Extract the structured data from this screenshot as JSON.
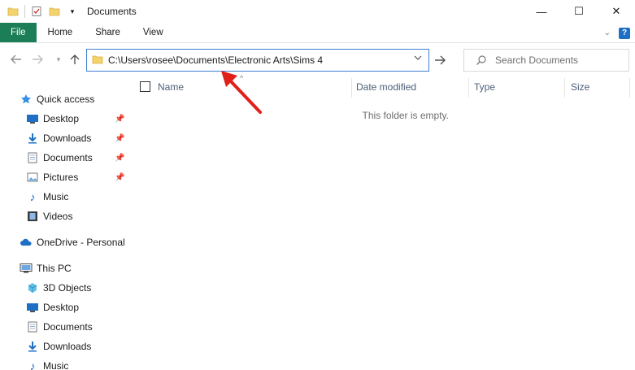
{
  "window": {
    "title": "Documents",
    "controls": {
      "minimize": "—",
      "maximize": "☐",
      "close": "✕"
    }
  },
  "ribbon": {
    "tabs": [
      "File",
      "Home",
      "Share",
      "View"
    ]
  },
  "navigation": {
    "address_path": "C:\\Users\\rosee\\Documents\\Electronic Arts\\Sims 4",
    "search_placeholder": "Search Documents"
  },
  "sidebar": {
    "quick_access": {
      "label": "Quick access"
    },
    "quick_items": [
      {
        "label": "Desktop",
        "icon": "desktop-icon",
        "pinned": true
      },
      {
        "label": "Downloads",
        "icon": "downloads-icon",
        "pinned": true
      },
      {
        "label": "Documents",
        "icon": "documents-icon",
        "pinned": true
      },
      {
        "label": "Pictures",
        "icon": "pictures-icon",
        "pinned": true
      },
      {
        "label": "Music",
        "icon": "music-icon",
        "pinned": false
      },
      {
        "label": "Videos",
        "icon": "videos-icon",
        "pinned": false
      }
    ],
    "onedrive": {
      "label": "OneDrive - Personal"
    },
    "this_pc": {
      "label": "This PC"
    },
    "pc_items": [
      {
        "label": "3D Objects",
        "icon": "3d-objects-icon"
      },
      {
        "label": "Desktop",
        "icon": "desktop-icon"
      },
      {
        "label": "Documents",
        "icon": "documents-icon"
      },
      {
        "label": "Downloads",
        "icon": "downloads-icon"
      },
      {
        "label": "Music",
        "icon": "music-icon"
      }
    ]
  },
  "content": {
    "columns": [
      "Name",
      "Date modified",
      "Type",
      "Size"
    ],
    "empty_message": "This folder is empty."
  },
  "colors": {
    "file_tab": "#1c7e57",
    "address_border": "#3f7fd0",
    "annotation_arrow": "#e0201b",
    "folder_yellow": "#f5d36b",
    "blue_icon": "#1f6fc5"
  }
}
